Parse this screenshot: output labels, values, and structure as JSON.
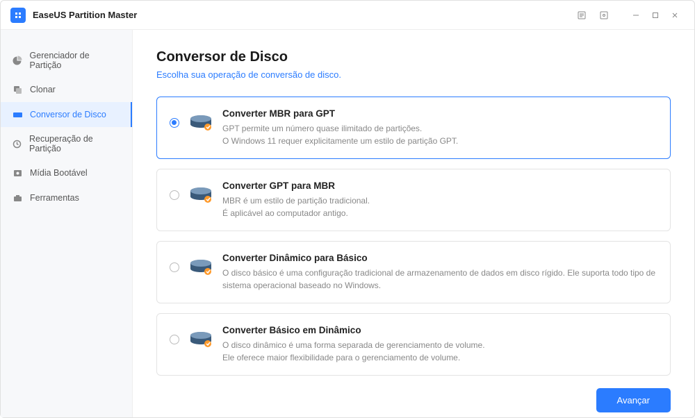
{
  "app": {
    "title": "EaseUS Partition Master"
  },
  "sidebar": {
    "items": [
      {
        "label": "Gerenciador de Partição",
        "icon": "pie"
      },
      {
        "label": "Clonar",
        "icon": "clone"
      },
      {
        "label": "Conversor de Disco",
        "icon": "disk",
        "active": true
      },
      {
        "label": "Recuperação de Partição",
        "icon": "recover"
      },
      {
        "label": "Mídia Bootável",
        "icon": "boot"
      },
      {
        "label": "Ferramentas",
        "icon": "tools"
      }
    ]
  },
  "page": {
    "title": "Conversor de Disco",
    "subtitle": "Escolha sua operação de conversão de disco."
  },
  "options": [
    {
      "title": "Converter MBR para GPT",
      "desc1": "GPT permite um número quase ilimitado de partições.",
      "desc2": "O Windows 11 requer explicitamente um estilo de partição GPT.",
      "selected": true
    },
    {
      "title": "Converter GPT para MBR",
      "desc1": "MBR é um estilo de partição tradicional.",
      "desc2": "É aplicável ao computador antigo.",
      "selected": false
    },
    {
      "title": "Converter Dinâmico para Básico",
      "desc1": "O disco básico é uma configuração tradicional de armazenamento de dados em disco rígido. Ele suporta todo tipo de sistema operacional baseado no Windows.",
      "desc2": "",
      "selected": false
    },
    {
      "title": "Converter Básico em Dinâmico",
      "desc1": "O disco dinâmico é uma forma separada de gerenciamento de volume.",
      "desc2": "Ele oferece maior flexibilidade para o gerenciamento de volume.",
      "selected": false
    }
  ],
  "footer": {
    "next": "Avançar"
  }
}
